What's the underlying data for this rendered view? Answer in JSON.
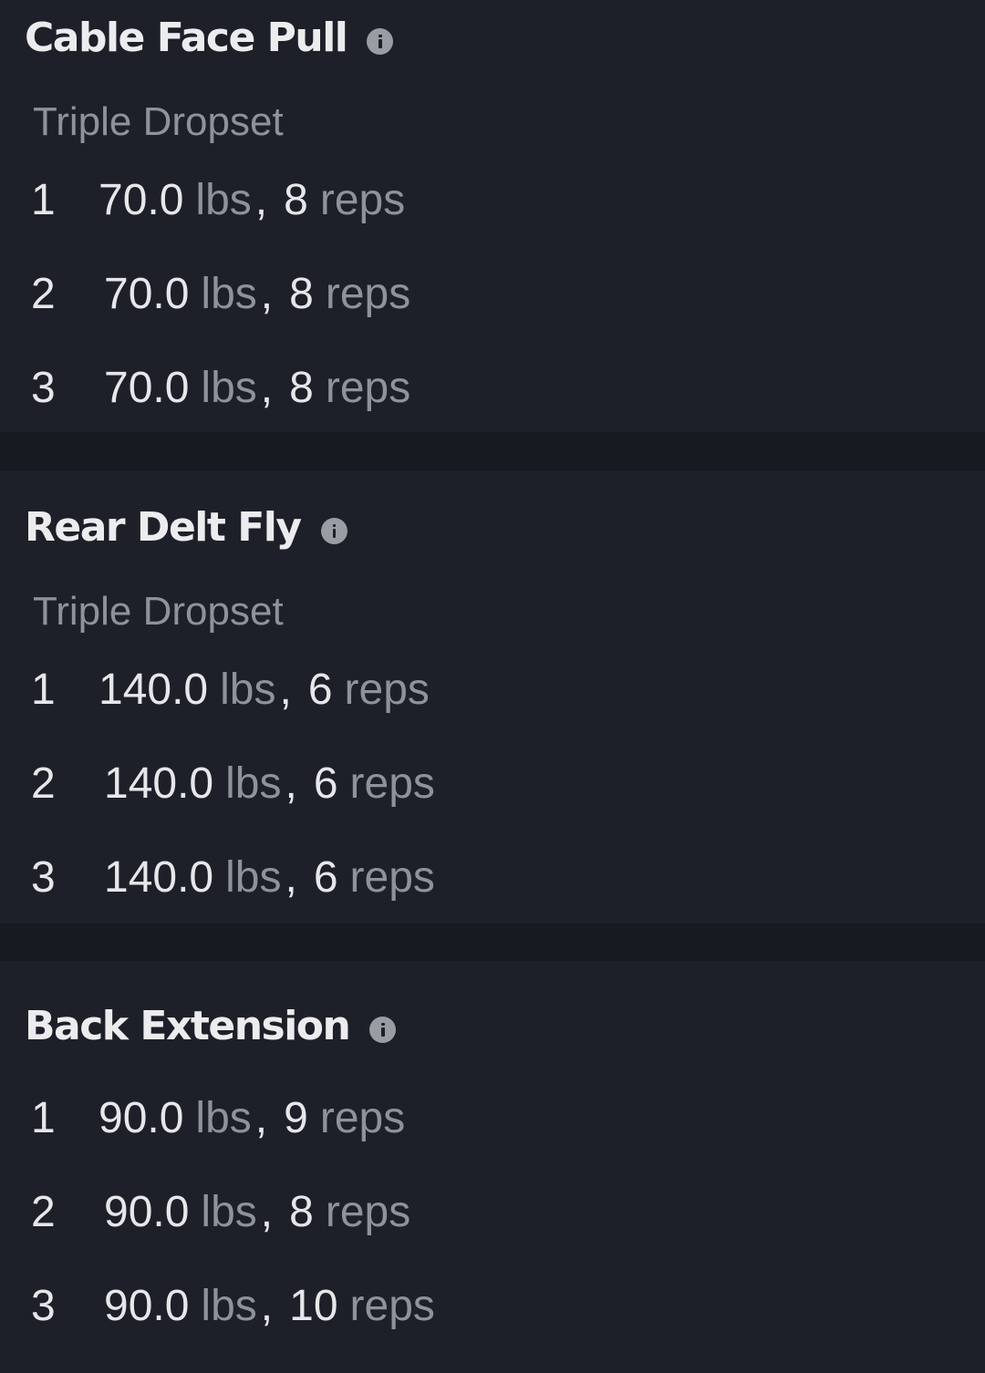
{
  "exercises": [
    {
      "name": "Cable Face Pull",
      "set_type": "Triple Dropset",
      "sets": [
        {
          "number": "1",
          "weight": "70.0",
          "unit": "lbs",
          "reps": "8",
          "reps_label": "reps"
        },
        {
          "number": "2",
          "weight": "70.0",
          "unit": "lbs",
          "reps": "8",
          "reps_label": "reps"
        },
        {
          "number": "3",
          "weight": "70.0",
          "unit": "lbs",
          "reps": "8",
          "reps_label": "reps"
        }
      ]
    },
    {
      "name": "Rear Delt Fly",
      "set_type": "Triple Dropset",
      "sets": [
        {
          "number": "1",
          "weight": "140.0",
          "unit": "lbs",
          "reps": "6",
          "reps_label": "reps"
        },
        {
          "number": "2",
          "weight": "140.0",
          "unit": "lbs",
          "reps": "6",
          "reps_label": "reps"
        },
        {
          "number": "3",
          "weight": "140.0",
          "unit": "lbs",
          "reps": "6",
          "reps_label": "reps"
        }
      ]
    },
    {
      "name": "Back Extension",
      "set_type": "",
      "sets": [
        {
          "number": "1",
          "weight": "90.0",
          "unit": "lbs",
          "reps": "9",
          "reps_label": "reps"
        },
        {
          "number": "2",
          "weight": "90.0",
          "unit": "lbs",
          "reps": "8",
          "reps_label": "reps"
        },
        {
          "number": "3",
          "weight": "90.0",
          "unit": "lbs",
          "reps": "10",
          "reps_label": "reps"
        }
      ]
    }
  ],
  "separator": ",",
  "colors": {
    "background": "#181a22",
    "card": "#1e2029",
    "text_primary": "#e6e7ea",
    "text_secondary": "#8f929b",
    "info_icon": "#9a9ca3"
  }
}
